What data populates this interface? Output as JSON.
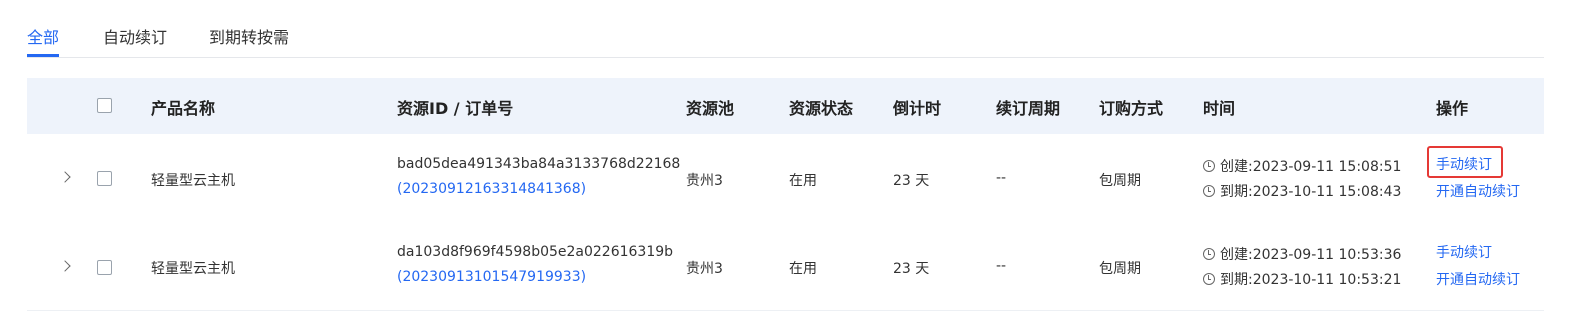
{
  "tabs": [
    {
      "label": "全部",
      "active": true
    },
    {
      "label": "自动续订",
      "active": false
    },
    {
      "label": "到期转按需",
      "active": false
    }
  ],
  "table": {
    "columns": [
      "产品名称",
      "资源ID / 订单号",
      "资源池",
      "资源状态",
      "倒计时",
      "续订周期",
      "订购方式",
      "时间",
      "操作"
    ],
    "rows": [
      {
        "product": "轻量型云主机",
        "resource_id": "bad05dea491343ba84a3133768d22168",
        "order_no": "(20230912163314841368)",
        "pool": "贵州3",
        "status": "在用",
        "countdown": "23 天",
        "renew_cycle": "--",
        "order_type": "包周期",
        "created": "创建:2023-09-11 15:08:51",
        "expires": "到期:2023-10-11 15:08:43",
        "action_manual": "手动续订",
        "action_auto": "开通自动续订"
      },
      {
        "product": "轻量型云主机",
        "resource_id": "da103d8f969f4598b05e2a022616319b",
        "order_no": "(20230913101547919933)",
        "pool": "贵州3",
        "status": "在用",
        "countdown": "23 天",
        "renew_cycle": "--",
        "order_type": "包周期",
        "created": "创建:2023-09-11 10:53:36",
        "expires": "到期:2023-10-11 10:53:21",
        "action_manual": "手动续订",
        "action_auto": "开通自动续订"
      }
    ]
  },
  "colors": {
    "accent": "#2468f2",
    "header_bg": "#eef3fb",
    "highlight": "#e53935"
  },
  "icons": {
    "expand": "chevron-right-icon",
    "time": "clock-icon"
  }
}
